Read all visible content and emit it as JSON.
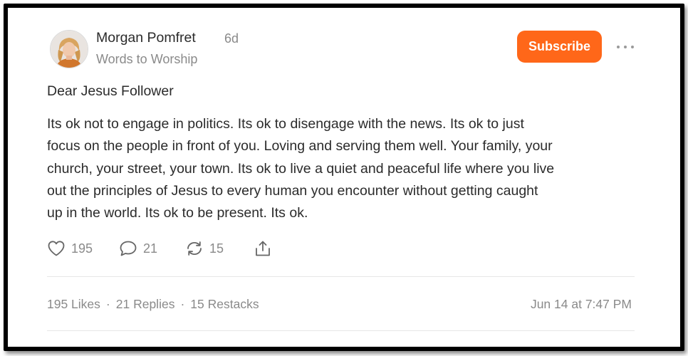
{
  "post": {
    "author": "Morgan Pomfret",
    "age": "6d",
    "publication": "Words to Worship",
    "subscribe_label": "Subscribe",
    "greeting": "Dear Jesus Follower",
    "body_lines": [
      "Its ok not to engage in politics. Its ok to disengage with the news. Its ok to just",
      "focus on the people in front of you. Loving and serving them well. Your family, your",
      "church, your street, your town. Its ok to live a quiet and peaceful life where you live",
      "out the principles of Jesus to every human you encounter without getting caught",
      "up in the world. Its ok to be present. Its ok."
    ]
  },
  "actions": {
    "like_count": "195",
    "reply_count": "21",
    "restack_count": "15"
  },
  "stats": {
    "likes": "195 Likes",
    "replies": "21 Replies",
    "restacks": "15 Restacks",
    "separator": "·",
    "timestamp": "Jun 14 at 7:47 PM"
  },
  "icons": [
    "heart-icon",
    "comment-icon",
    "restack-icon",
    "share-icon",
    "more-icon"
  ],
  "colors": {
    "accent": "#ff6719",
    "text": "#2b2b2b",
    "muted": "#8a8a8a"
  }
}
